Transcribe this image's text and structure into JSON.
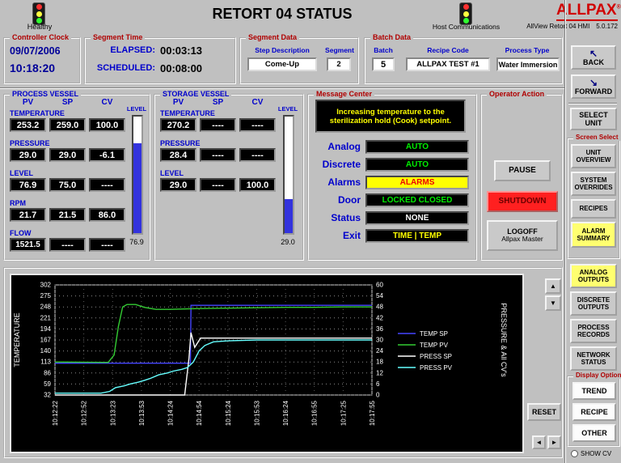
{
  "colors": {
    "background": "#c0c0c0",
    "brand_red": "#d00000",
    "label_blue": "#0000cc",
    "clock_navy": "#000099",
    "ok_green": "#00ee00",
    "alarm_yellow": "#ffff00",
    "alarm_red": "#ee0000",
    "shutdown_red": "#ff2020",
    "level_fill_blue": "#3333dd"
  },
  "header": {
    "title": "RETORT 04 STATUS",
    "left_status": "Healthy",
    "right_status": "Host Communications",
    "brand": "ALLPAX",
    "brand_reg": "®",
    "app_info": "AllView Retort 04 HMI",
    "version": "5.0.172"
  },
  "controller_clock": {
    "title": "Controller Clock",
    "date": "09/07/2006",
    "time": "10:18:20"
  },
  "segment_time": {
    "title": "Segment Time",
    "elapsed_label": "ELAPSED:",
    "elapsed": "00:03:13",
    "scheduled_label": "SCHEDULED:",
    "scheduled": "00:08:00"
  },
  "segment_data": {
    "title": "Segment Data",
    "step_description_label": "Step Description",
    "step_description": "Come-Up",
    "segment_label": "Segment",
    "segment": "2"
  },
  "batch_data": {
    "title": "Batch Data",
    "batch_label": "Batch",
    "batch": "5",
    "recipe_code_label": "Recipe Code",
    "recipe_code": "ALLPAX TEST #1",
    "process_type_label": "Process Type",
    "process_type": "Water Immersion"
  },
  "process_vessel": {
    "title": "PROCESS VESSEL",
    "columns": [
      "PV",
      "SP",
      "CV"
    ],
    "rows": [
      {
        "label": "TEMPERATURE",
        "pv": "253.2",
        "sp": "259.0",
        "cv": "100.0"
      },
      {
        "label": "PRESSURE",
        "pv": "29.0",
        "sp": "29.0",
        "cv": "-6.1"
      },
      {
        "label": "LEVEL",
        "pv": "76.9",
        "sp": "75.0",
        "cv": "----"
      },
      {
        "label": "RPM",
        "pv": "21.7",
        "sp": "21.5",
        "cv": "86.0"
      },
      {
        "label": "FLOW",
        "pv": "1521.5",
        "sp": "----",
        "cv": "----"
      }
    ],
    "level_label": "LEVEL",
    "level_value": "76.9",
    "level_percent": 77
  },
  "storage_vessel": {
    "title": "STORAGE VESSEL",
    "columns": [
      "PV",
      "SP",
      "CV"
    ],
    "rows": [
      {
        "label": "TEMPERATURE",
        "pv": "270.2",
        "sp": "----",
        "cv": "----"
      },
      {
        "label": "PRESSURE",
        "pv": "28.4",
        "sp": "----",
        "cv": "----"
      },
      {
        "label": "LEVEL",
        "pv": "29.0",
        "sp": "----",
        "cv": "100.0"
      }
    ],
    "level_label": "LEVEL",
    "level_value": "29.0",
    "level_percent": 29
  },
  "message_center": {
    "title": "Message Center",
    "message": "Increasing temperature to the sterilization hold (Cook) setpoint.",
    "rows": [
      {
        "label": "Analog",
        "value": "AUTO",
        "style": "green"
      },
      {
        "label": "Discrete",
        "value": "AUTO",
        "style": "green"
      },
      {
        "label": "Alarms",
        "value": "ALARMS",
        "style": "alarm"
      },
      {
        "label": "Door",
        "value": "LOCKED CLOSED",
        "style": "green"
      },
      {
        "label": "Status",
        "value": "NONE",
        "style": "white"
      },
      {
        "label": "Exit",
        "value": "TIME | TEMP",
        "style": "yellow"
      }
    ]
  },
  "operator_action": {
    "title": "Operator Action",
    "pause_label": "PAUSE",
    "shutdown_label": "SHUTDOWN",
    "logoff_line1": "LOGOFF",
    "logoff_line2": "Allpax Master"
  },
  "sidebar": {
    "back_label": "BACK",
    "back_icon": "↖",
    "forward_label": "FORWARD",
    "forward_icon": "↘",
    "select_unit_label": "SELECT UNIT",
    "screen_select_title": "Screen Select",
    "screen_buttons": [
      "UNIT OVERVIEW",
      "SYSTEM OVERRIDES",
      "RECIPES",
      "ALARM SUMMARY"
    ],
    "output_buttons": [
      "ANALOG OUTPUTS",
      "DISCRETE OUTPUTS",
      "PROCESS RECORDS",
      "NETWORK STATUS"
    ],
    "display_options_title": "Display Options",
    "display_buttons": [
      "TREND",
      "RECIPE",
      "OTHER"
    ],
    "show_cv_label": "SHOW CV"
  },
  "trend": {
    "reset_label": "RESET",
    "scroll_up_icon": "▲",
    "scroll_down_icon": "▼",
    "scroll_left_icon": "◄",
    "scroll_right_icon": "►"
  },
  "chart_data": {
    "type": "line",
    "ylabel_left": "TEMPERATURE",
    "ylabel_right": "PRESSURE & All CV's",
    "grid": true,
    "legend_position": "right",
    "temp_axis": {
      "min": 32,
      "max": 302,
      "ticks": [
        302,
        275,
        248,
        221,
        194,
        167,
        140,
        113,
        86,
        59,
        32
      ]
    },
    "press_axis": {
      "min": 0,
      "max": 60,
      "ticks": [
        60,
        54,
        48,
        42,
        36,
        30,
        24,
        18,
        12,
        6,
        0
      ]
    },
    "x_ticks": [
      "10:12:22",
      "10:12:52",
      "10:13:23",
      "10:13:53",
      "10:14:24",
      "10:14:54",
      "10:15:24",
      "10:15:53",
      "10:16:24",
      "10:16:55",
      "10:17:25",
      "10:17:55"
    ],
    "series": [
      {
        "name": "TEMP SP",
        "color": "#4444ff",
        "scale": "temp",
        "points": [
          [
            0,
            110
          ],
          [
            4.7,
            110
          ],
          [
            4.72,
            252
          ],
          [
            11,
            252
          ]
        ]
      },
      {
        "name": "TEMP PV",
        "color": "#33cc33",
        "scale": "temp",
        "points": [
          [
            0,
            113
          ],
          [
            1.85,
            112
          ],
          [
            2.05,
            130
          ],
          [
            2.2,
            200
          ],
          [
            2.35,
            248
          ],
          [
            2.5,
            254
          ],
          [
            2.8,
            254
          ],
          [
            3.1,
            247
          ],
          [
            3.5,
            242
          ],
          [
            4,
            242
          ],
          [
            4.5,
            243
          ],
          [
            5,
            244
          ],
          [
            6,
            245
          ],
          [
            7,
            246
          ],
          [
            8,
            247
          ],
          [
            9,
            247
          ],
          [
            10,
            248
          ],
          [
            11,
            248
          ]
        ]
      },
      {
        "name": "PRESS SP",
        "color": "#ffffff",
        "scale": "press",
        "points": [
          [
            0,
            0
          ],
          [
            4.5,
            0
          ],
          [
            4.65,
            20
          ],
          [
            4.72,
            34
          ],
          [
            4.85,
            26
          ],
          [
            5.05,
            31
          ],
          [
            11,
            31
          ]
        ]
      },
      {
        "name": "PRESS PV",
        "color": "#66ffff",
        "scale": "press",
        "points": [
          [
            0,
            1
          ],
          [
            1.6,
            1
          ],
          [
            1.9,
            2
          ],
          [
            2.1,
            4
          ],
          [
            2.4,
            5
          ],
          [
            2.6,
            6
          ],
          [
            2.9,
            7
          ],
          [
            3.1,
            8
          ],
          [
            3.3,
            9
          ],
          [
            3.6,
            11
          ],
          [
            3.9,
            12
          ],
          [
            4.1,
            13
          ],
          [
            4.4,
            14
          ],
          [
            4.6,
            15
          ],
          [
            4.8,
            18
          ],
          [
            5,
            24
          ],
          [
            5.2,
            27
          ],
          [
            5.5,
            29
          ],
          [
            6,
            29.5
          ],
          [
            7,
            30
          ],
          [
            8,
            30
          ],
          [
            9,
            30
          ],
          [
            10,
            30
          ],
          [
            11,
            30
          ]
        ]
      }
    ]
  }
}
